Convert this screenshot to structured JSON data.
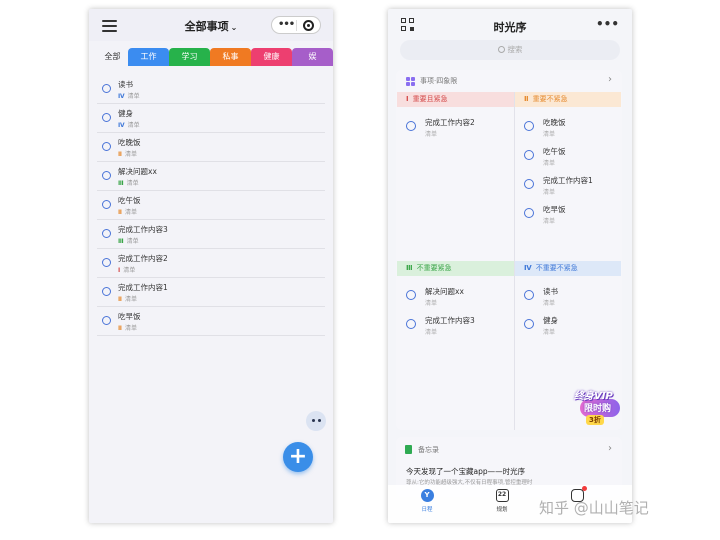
{
  "left_screen": {
    "header": {
      "title": "全部事项",
      "chevron": "chevron-down-icon"
    },
    "tabs": [
      {
        "label": "全部"
      },
      {
        "label": "工作"
      },
      {
        "label": "学习"
      },
      {
        "label": "私事"
      },
      {
        "label": "健康"
      },
      {
        "label": "娱"
      }
    ],
    "items": [
      {
        "title": "读书",
        "level": "Ⅳ",
        "sub": "清单",
        "color": "#3f78d8"
      },
      {
        "title": "健身",
        "level": "Ⅳ",
        "sub": "清单",
        "color": "#3f78d8"
      },
      {
        "title": "吃晚饭",
        "level": "Ⅱ",
        "sub": "清单",
        "color": "#e68a2e"
      },
      {
        "title": "解决问题xx",
        "level": "Ⅲ",
        "sub": "清单",
        "color": "#3aa548"
      },
      {
        "title": "吃午饭",
        "level": "Ⅱ",
        "sub": "清单",
        "color": "#e68a2e"
      },
      {
        "title": "完成工作内容3",
        "level": "Ⅲ",
        "sub": "清单",
        "color": "#3aa548"
      },
      {
        "title": "完成工作内容2",
        "level": "Ⅰ",
        "sub": "清单",
        "color": "#d44a4a"
      },
      {
        "title": "完成工作内容1",
        "level": "Ⅱ",
        "sub": "清单",
        "color": "#e68a2e"
      },
      {
        "title": "吃早饭",
        "level": "Ⅱ",
        "sub": "清单",
        "color": "#e68a2e"
      }
    ],
    "fab_label": "+"
  },
  "right_screen": {
    "header": {
      "title": "时光序",
      "more": "•••"
    },
    "search": {
      "placeholder": "搜索"
    },
    "quadrant_card": {
      "label": "事项·四象限",
      "arrow": "›"
    },
    "quadrants": [
      {
        "num": "Ⅰ",
        "name": "重要且紧急",
        "items": [
          {
            "title": "完成工作内容2",
            "sub": "清单"
          }
        ]
      },
      {
        "num": "Ⅱ",
        "name": "重要不紧急",
        "items": [
          {
            "title": "吃晚饭",
            "sub": "清单"
          },
          {
            "title": "吃午饭",
            "sub": "清单"
          },
          {
            "title": "完成工作内容1",
            "sub": "清单"
          },
          {
            "title": "吃早饭",
            "sub": "清单"
          }
        ]
      },
      {
        "num": "Ⅲ",
        "name": "不重要紧急",
        "items": [
          {
            "title": "解决问题xx",
            "sub": "清单"
          },
          {
            "title": "完成工作内容3",
            "sub": "清单"
          }
        ]
      },
      {
        "num": "Ⅳ",
        "name": "不重要不紧急",
        "items": [
          {
            "title": "读书",
            "sub": "清单"
          },
          {
            "title": "健身",
            "sub": "清单"
          }
        ]
      }
    ],
    "vip_badge": {
      "line1": "终身VIP",
      "line2": "限时购",
      "line3": "3折"
    },
    "memo": {
      "label": "备忘录",
      "arrow": "›",
      "text": "今天发现了一个宝藏app——时光序",
      "sub": "尊从:它的功能超级强大,不仅有日程事项,管控重理时"
    },
    "tabbar": [
      {
        "label": "日程",
        "icon_text": "Y"
      },
      {
        "label": "规划",
        "icon_text": "22"
      },
      {
        "label": "",
        "icon_text": ""
      }
    ]
  },
  "watermark": "知乎 @山山笔记"
}
